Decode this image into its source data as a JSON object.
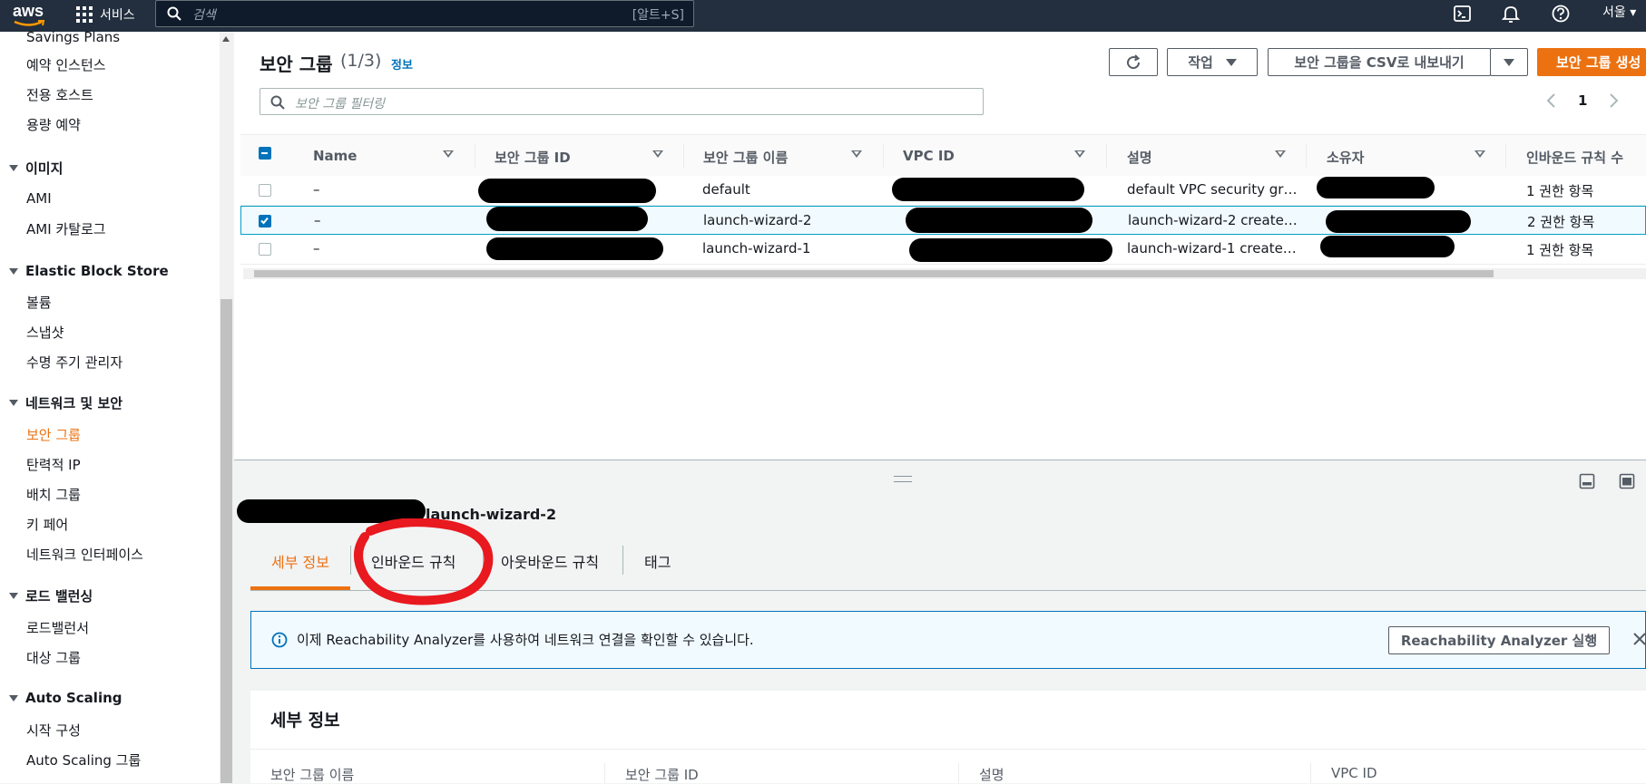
{
  "topbar": {
    "logo": "aws",
    "services_label": "서비스",
    "search_placeholder": "검색",
    "search_shortcut": "[알트+S]",
    "region": "서울 ▾",
    "icons": [
      "cloudshell-icon",
      "bell-icon",
      "help-icon"
    ]
  },
  "sidebar": {
    "items_top": [
      "Savings Plans",
      "예약 인스턴스",
      "전용 호스트",
      "용량 예약"
    ],
    "sec_images": "이미지",
    "images_items": [
      "AMI",
      "AMI 카탈로그"
    ],
    "sec_ebs": "Elastic Block Store",
    "ebs_items": [
      "볼륨",
      "스냅샷",
      "수명 주기 관리자"
    ],
    "sec_network": "네트워크 및 보안",
    "network_items": [
      "보안 그룹",
      "탄력적 IP",
      "배치 그룹",
      "키 페어",
      "네트워크 인터페이스"
    ],
    "sec_lb": "로드 밸런싱",
    "lb_items": [
      "로드밸런서",
      "대상 그룹"
    ],
    "sec_as": "Auto Scaling",
    "as_items": [
      "시작 구성",
      "Auto Scaling 그룹"
    ]
  },
  "panel": {
    "title": "보안 그룹",
    "count": "(1/3)",
    "info": "정보",
    "actions_label": "작업",
    "export_label": "보안 그룹을 CSV로 내보내기",
    "create_label": "보안 그룹 생성",
    "filter_placeholder": "보안 그룹 필터링",
    "page": "1"
  },
  "table": {
    "columns": [
      "Name",
      "보안 그룹 ID",
      "보안 그룹 이름",
      "VPC ID",
      "설명",
      "소유자",
      "인바운드 규칙 수"
    ],
    "rows": [
      {
        "name": "–",
        "group_name": "default",
        "description": "default VPC security gr…",
        "inbound": "1 권한 항목",
        "selected": false
      },
      {
        "name": "–",
        "group_name": "launch-wizard-2",
        "description": "launch-wizard-2 create…",
        "inbound": "2 권한 항목",
        "selected": true
      },
      {
        "name": "–",
        "group_name": "launch-wizard-1",
        "description": "launch-wizard-1 create…",
        "inbound": "1 권한 항목",
        "selected": false
      }
    ]
  },
  "lower": {
    "selected_title": "launch-wizard-2",
    "tabs": [
      "세부 정보",
      "인바운드 규칙",
      "아웃바운드 규칙",
      "태그"
    ],
    "alert_message": "이제 Reachability Analyzer를 사용하여 네트워크 연결을 확인할 수 있습니다.",
    "alert_button": "Reachability Analyzer 실행",
    "detail_title": "세부 정보",
    "detail_columns": [
      "보안 그룹 이름",
      "보안 그룹 ID",
      "설명",
      "VPC ID"
    ]
  },
  "colors": {
    "topbar": "#232f3e",
    "accent": "#ec7211",
    "link": "#0073bb",
    "annotation": "#e8191f"
  }
}
